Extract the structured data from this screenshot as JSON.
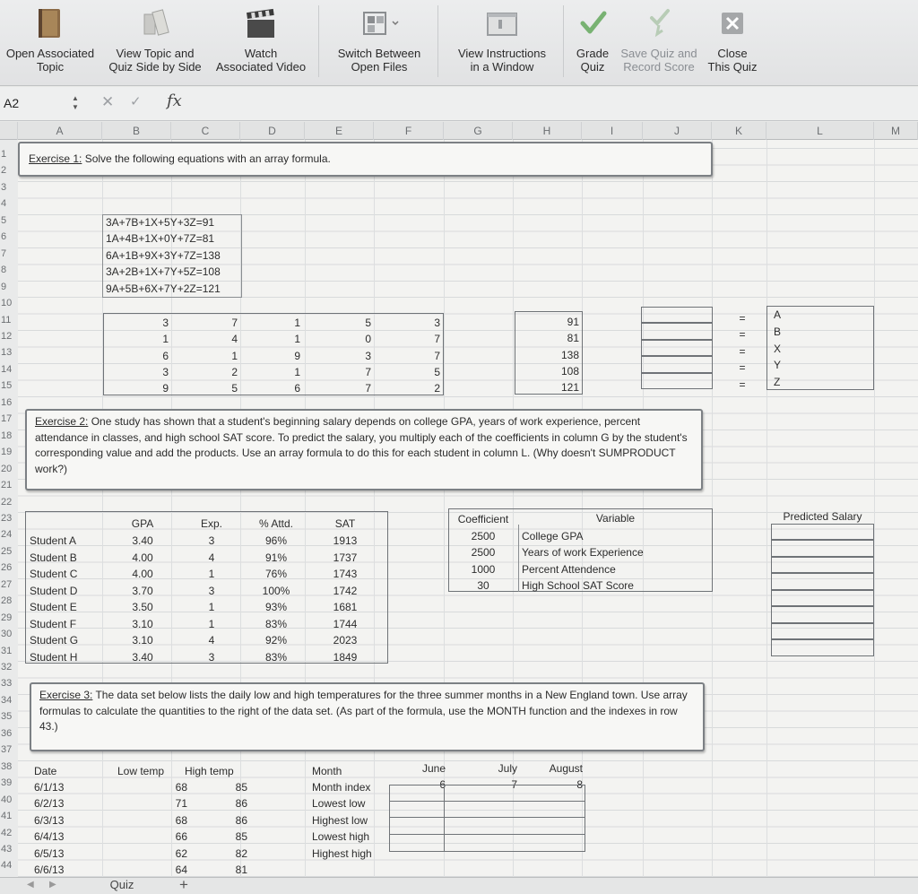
{
  "ribbon": {
    "buttons": [
      {
        "id": "open_topic",
        "label": "Open Associated\nTopic",
        "icon": "book-icon"
      },
      {
        "id": "side_by_side",
        "label": "View Topic and\nQuiz Side by Side",
        "icon": "side-by-side-icon"
      },
      {
        "id": "watch_video",
        "label": "Watch\nAssociated Video",
        "icon": "clapperboard-icon"
      },
      {
        "id": "switch_files",
        "label": "Switch Between\nOpen Files",
        "icon": "windows-icon"
      },
      {
        "id": "view_instructions",
        "label": "View Instructions\nin a Window",
        "icon": "window-icon"
      },
      {
        "id": "grade_quiz",
        "label": "Grade\nQuiz",
        "icon": "checkmark-icon"
      },
      {
        "id": "save_quiz",
        "label": "Save Quiz and\nRecord Score",
        "icon": "save-check-icon"
      },
      {
        "id": "close_quiz",
        "label": "Close\nThis Quiz",
        "icon": "close-icon"
      }
    ]
  },
  "formula_bar": {
    "name_box": "A2",
    "fx": "fx",
    "value": ""
  },
  "columns": [
    "A",
    "B",
    "C",
    "D",
    "E",
    "F",
    "G",
    "H",
    "I",
    "J",
    "K",
    "L",
    "M"
  ],
  "rows": [
    "1",
    "2",
    "3",
    "4",
    "5",
    "6",
    "7",
    "8",
    "9",
    "10",
    "11",
    "12",
    "13",
    "14",
    "15",
    "16",
    "17",
    "18",
    "19",
    "20",
    "21",
    "22",
    "23",
    "24",
    "25",
    "26",
    "27",
    "28",
    "29",
    "30",
    "31",
    "32",
    "33",
    "34",
    "35",
    "36",
    "37",
    "38",
    "39",
    "40",
    "41",
    "42",
    "43",
    "44"
  ],
  "exercise1": {
    "title": "Exercise 1:",
    "text": " Solve the following equations with an array formula.",
    "equations": [
      "3A+7B+1X+5Y+3Z=91",
      "1A+4B+1X+0Y+7Z=81",
      "6A+1B+9X+3Y+7Z=138",
      "3A+2B+1X+7Y+5Z=108",
      "9A+5B+6X+7Y+2Z=121"
    ],
    "matrix": [
      [
        3,
        7,
        1,
        5,
        3
      ],
      [
        1,
        4,
        1,
        0,
        7
      ],
      [
        6,
        1,
        9,
        3,
        7
      ],
      [
        3,
        2,
        1,
        7,
        5
      ],
      [
        9,
        5,
        6,
        7,
        2
      ]
    ],
    "constants": [
      91,
      81,
      138,
      108,
      121
    ],
    "equals": [
      "=",
      "=",
      "=",
      "=",
      "="
    ],
    "variables": [
      "A",
      "B",
      "X",
      "Y",
      "Z"
    ]
  },
  "exercise2": {
    "title": "Exercise 2:",
    "text": " One study has shown that a student's beginning salary depends on college GPA, years of work experience, percent attendance in classes, and high school SAT score. To predict the salary, you multiply each of the coefficients in column G by the student's corresponding value and add the products. Use an array formula to do this for each student in column L. (Why doesn't SUMPRODUCT work?)",
    "headers": [
      "GPA",
      "Exp.",
      "% Attd.",
      "SAT"
    ],
    "students": [
      {
        "name": "Student A",
        "gpa": "3.40",
        "exp": "3",
        "attd": "96%",
        "sat": "1913"
      },
      {
        "name": "Student B",
        "gpa": "4.00",
        "exp": "4",
        "attd": "91%",
        "sat": "1737"
      },
      {
        "name": "Student C",
        "gpa": "4.00",
        "exp": "1",
        "attd": "76%",
        "sat": "1743"
      },
      {
        "name": "Student D",
        "gpa": "3.70",
        "exp": "3",
        "attd": "100%",
        "sat": "1742"
      },
      {
        "name": "Student E",
        "gpa": "3.50",
        "exp": "1",
        "attd": "93%",
        "sat": "1681"
      },
      {
        "name": "Student F",
        "gpa": "3.10",
        "exp": "1",
        "attd": "83%",
        "sat": "1744"
      },
      {
        "name": "Student G",
        "gpa": "3.10",
        "exp": "4",
        "attd": "92%",
        "sat": "2023"
      },
      {
        "name": "Student H",
        "gpa": "3.40",
        "exp": "3",
        "attd": "83%",
        "sat": "1849"
      }
    ],
    "coef_header": "Coefficient",
    "var_header": "Variable",
    "coefficients": [
      {
        "value": "2500",
        "variable": "College GPA"
      },
      {
        "value": "2500",
        "variable": "Years of work Experience"
      },
      {
        "value": "1000",
        "variable": "Percent Attendence"
      },
      {
        "value": "30",
        "variable": "High School SAT Score"
      }
    ],
    "predicted_header": "Predicted Salary"
  },
  "exercise3": {
    "title": "Exercise 3:",
    "text": " The data set below lists the daily low and high temperatures for the three summer months in a New England town. Use array formulas to calculate the quantities to the right of the data set. (As part of the formula, use the MONTH function and the indexes in row 43.)",
    "headers": [
      "Date",
      "Low temp",
      "High temp"
    ],
    "data": [
      {
        "date": "6/1/13",
        "low": "68",
        "high": "85"
      },
      {
        "date": "6/2/13",
        "low": "71",
        "high": "86"
      },
      {
        "date": "6/3/13",
        "low": "68",
        "high": "86"
      },
      {
        "date": "6/4/13",
        "low": "66",
        "high": "85"
      },
      {
        "date": "6/5/13",
        "low": "62",
        "high": "82"
      },
      {
        "date": "6/6/13",
        "low": "64",
        "high": "81"
      }
    ],
    "month_label": "Month",
    "labels": [
      "Month index",
      "Lowest low",
      "Highest low",
      "Lowest high",
      "Highest high"
    ],
    "months": [
      "June",
      "July",
      "August"
    ],
    "month_indexes": [
      "6",
      "7",
      "8"
    ]
  },
  "tabs": {
    "sheet": "Quiz",
    "add": "+"
  }
}
